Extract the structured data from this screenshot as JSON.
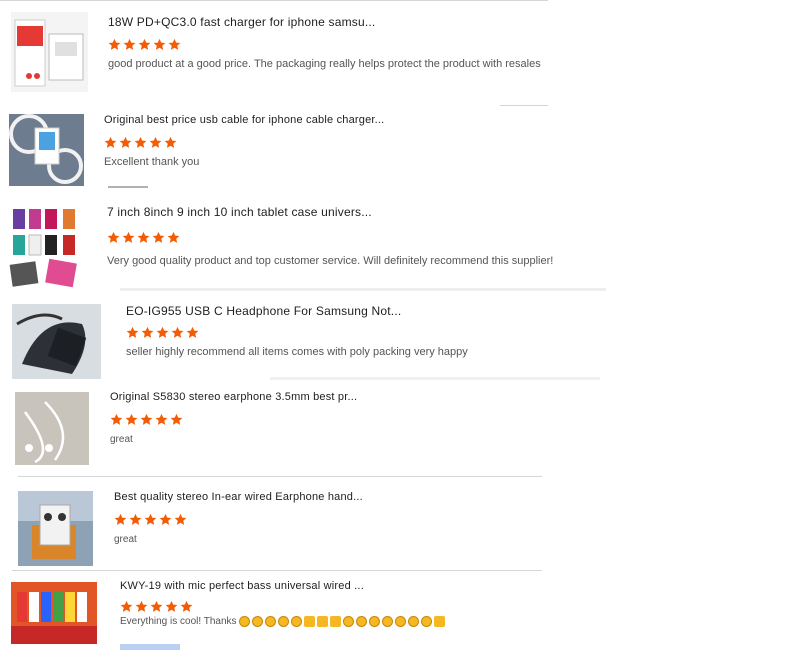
{
  "reviews": [
    {
      "title": "18W PD+QC3.0 fast charger for iphone samsu...",
      "rating": 5,
      "comment": "good product at a good price. The packaging really helps protect the product with resales",
      "image": "charger-box-image"
    },
    {
      "title": "Original best price usb cable for iphone cable charger...",
      "rating": 5,
      "comment": "Excellent thank you",
      "image": "usb-cable-image"
    },
    {
      "title": "7 inch 8inch 9 inch 10 inch tablet case univers...",
      "rating": 5,
      "comment": "Very good quality product and top customer service. Will definitely recommend this supplier!",
      "image": "tablet-cases-image"
    },
    {
      "title": "EO-IG955 USB C Headphone For Samsung Not...",
      "rating": 5,
      "comment": "seller highly recommend all items comes with poly packing very happy",
      "image": "headphone-image"
    },
    {
      "title": "Original S5830 stereo earphone 3.5mm best pr...",
      "rating": 5,
      "comment": "great",
      "image": "earphone-image"
    },
    {
      "title": "Best quality stereo In-ear wired Earphone hand...",
      "rating": 5,
      "comment": "great",
      "image": "wired-earphone-image"
    },
    {
      "title": "KWY-19 with mic perfect bass universal wired ...",
      "rating": 5,
      "comment": "Everything is cool! Thanks",
      "image": "kwy-earphones-image"
    }
  ],
  "colors": {
    "star": "#f25c05",
    "title": "#1e1e1e",
    "comment": "#555555",
    "divider": "#d6d6d6"
  }
}
